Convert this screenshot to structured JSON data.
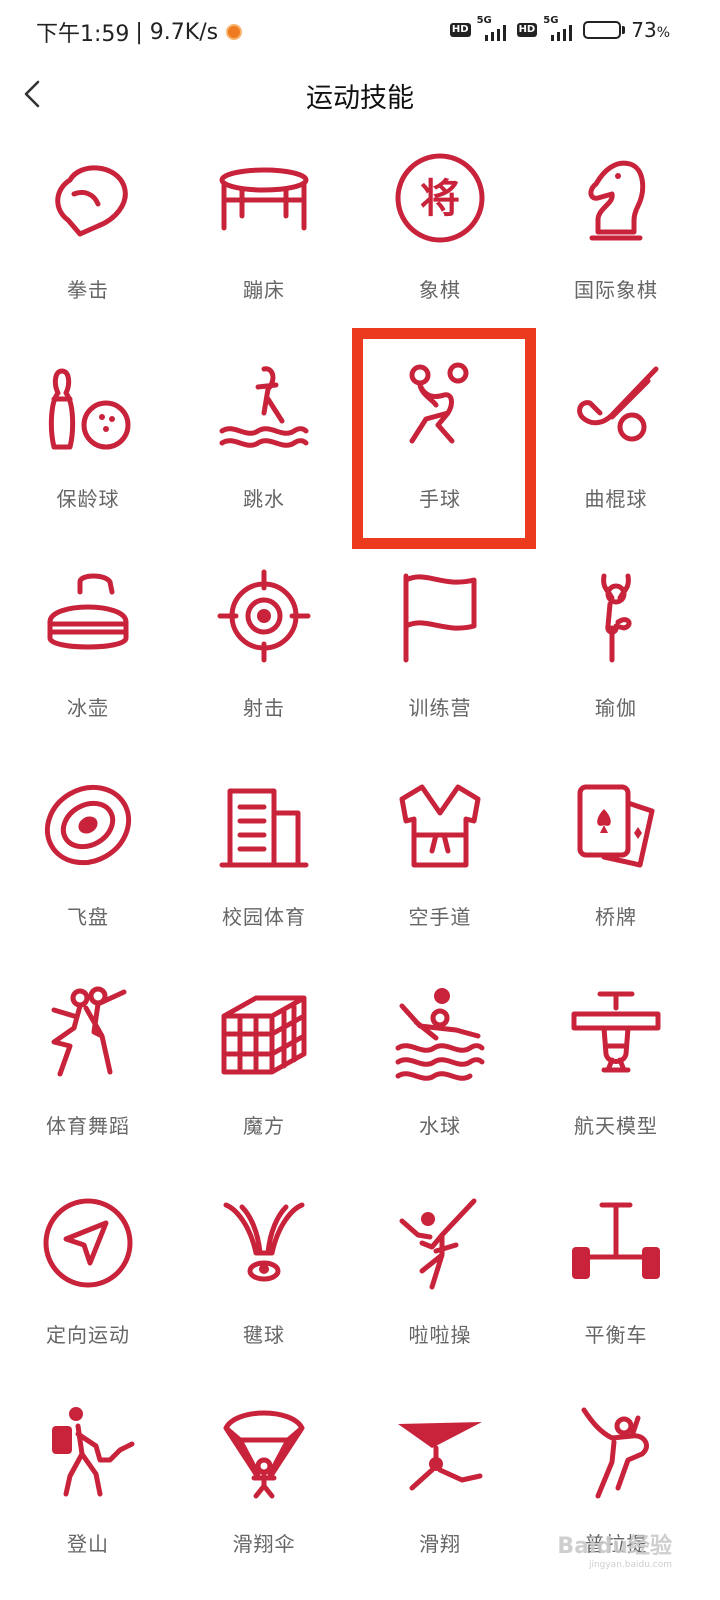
{
  "status_bar": {
    "time": "下午1:59",
    "speed": "| 9.7K/s",
    "hd": "HD",
    "net": "5G",
    "battery": "73",
    "battery_unit": "%",
    "battery_level": 0.73
  },
  "header": {
    "title": "运动技能"
  },
  "accent_color": "#c8233a",
  "highlight_color": "#ec3a1f",
  "items": [
    {
      "label": "拳击",
      "icon": "boxing-glove-icon"
    },
    {
      "label": "蹦床",
      "icon": "trampoline-icon"
    },
    {
      "label": "象棋",
      "icon": "chinese-chess-icon"
    },
    {
      "label": "国际象棋",
      "icon": "chess-knight-icon"
    },
    {
      "label": "保龄球",
      "icon": "bowling-icon"
    },
    {
      "label": "跳水",
      "icon": "diving-icon"
    },
    {
      "label": "手球",
      "icon": "handball-icon"
    },
    {
      "label": "曲棍球",
      "icon": "hockey-icon"
    },
    {
      "label": "冰壶",
      "icon": "curling-icon"
    },
    {
      "label": "射击",
      "icon": "target-icon"
    },
    {
      "label": "训练营",
      "icon": "flag-icon"
    },
    {
      "label": "瑜伽",
      "icon": "yoga-icon"
    },
    {
      "label": "飞盘",
      "icon": "frisbee-icon"
    },
    {
      "label": "校园体育",
      "icon": "building-icon"
    },
    {
      "label": "空手道",
      "icon": "karate-uniform-icon"
    },
    {
      "label": "桥牌",
      "icon": "playing-cards-icon"
    },
    {
      "label": "体育舞蹈",
      "icon": "dance-couple-icon"
    },
    {
      "label": "魔方",
      "icon": "rubiks-cube-icon"
    },
    {
      "label": "水球",
      "icon": "water-polo-icon"
    },
    {
      "label": "航天模型",
      "icon": "airplane-model-icon"
    },
    {
      "label": "定向运动",
      "icon": "compass-arrow-icon"
    },
    {
      "label": "毽球",
      "icon": "shuttlecock-icon"
    },
    {
      "label": "啦啦操",
      "icon": "cheerleader-icon"
    },
    {
      "label": "平衡车",
      "icon": "balance-scooter-icon"
    },
    {
      "label": "登山",
      "icon": "hiker-icon"
    },
    {
      "label": "滑翔伞",
      "icon": "paraglider-icon"
    },
    {
      "label": "滑翔",
      "icon": "hang-glider-icon"
    },
    {
      "label": "普拉提",
      "icon": "pilates-icon"
    }
  ],
  "highlighted_index": 6,
  "watermark": {
    "text": "Baidu经验",
    "sub": "jingyan.baidu.com"
  }
}
